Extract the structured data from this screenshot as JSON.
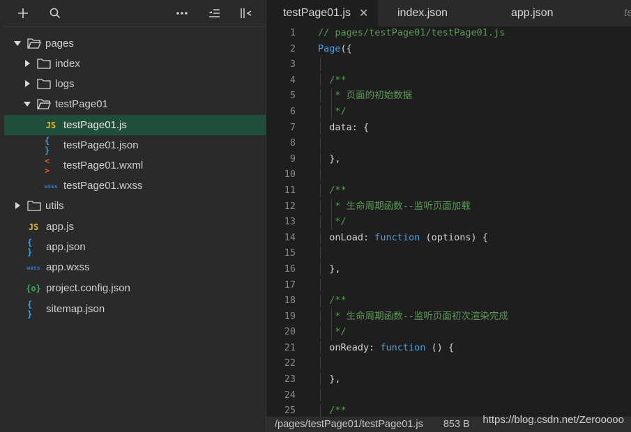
{
  "toolbar": {
    "add_icon": "plus-icon",
    "search_icon": "search-icon",
    "more_icon": "ellipsis-icon",
    "collapse_icon": "collapse-all-icon",
    "hide_panel_icon": "hide-sidebar-icon"
  },
  "tree": [
    {
      "label": "pages",
      "type": "folder",
      "expanded": true,
      "depth": 0
    },
    {
      "label": "index",
      "type": "folder",
      "expanded": false,
      "depth": 1
    },
    {
      "label": "logs",
      "type": "folder",
      "expanded": false,
      "depth": 1
    },
    {
      "label": "testPage01",
      "type": "folder",
      "expanded": true,
      "depth": 1
    },
    {
      "label": "testPage01.js",
      "type": "js",
      "badge": "JS",
      "depth": 2,
      "selected": true
    },
    {
      "label": "testPage01.json",
      "type": "json",
      "badge": "{ }",
      "depth": 2
    },
    {
      "label": "testPage01.wxml",
      "type": "wxml",
      "badge": "< >",
      "depth": 2
    },
    {
      "label": "testPage01.wxss",
      "type": "wxss",
      "badge": "wxss",
      "depth": 2
    },
    {
      "label": "utils",
      "type": "folder",
      "expanded": false,
      "depth": 0
    },
    {
      "label": "app.js",
      "type": "js",
      "badge": "JS",
      "depth": 1
    },
    {
      "label": "app.json",
      "type": "json",
      "badge": "{ }",
      "depth": 1
    },
    {
      "label": "app.wxss",
      "type": "wxss",
      "badge": "wxss",
      "depth": 1
    },
    {
      "label": "project.config.json",
      "type": "config",
      "badge": "{o}",
      "depth": 1
    },
    {
      "label": "sitemap.json",
      "type": "json",
      "badge": "{ }",
      "depth": 1
    }
  ],
  "tabs": [
    {
      "label": "testPage01.js",
      "active": true,
      "close": "✕"
    },
    {
      "label": "index.json",
      "active": false
    },
    {
      "label": "app.json",
      "active": false
    },
    {
      "label": "te",
      "active": false
    }
  ],
  "code": [
    {
      "n": "1",
      "tokens": [
        {
          "t": "// pages/testPage01/testPage01.js",
          "k": "comment"
        }
      ]
    },
    {
      "n": "2",
      "tokens": [
        {
          "t": "Page",
          "k": "func"
        },
        {
          "t": "({",
          "k": "punc"
        }
      ]
    },
    {
      "n": "3",
      "tokens": []
    },
    {
      "n": "4",
      "tokens": [
        {
          "t": "  /**",
          "k": "comment"
        }
      ]
    },
    {
      "n": "5",
      "tokens": [
        {
          "t": "   * 页面的初始数据",
          "k": "comment"
        }
      ]
    },
    {
      "n": "6",
      "tokens": [
        {
          "t": "   */",
          "k": "comment"
        }
      ]
    },
    {
      "n": "7",
      "tokens": [
        {
          "t": "  data: {",
          "k": "key"
        }
      ]
    },
    {
      "n": "8",
      "tokens": []
    },
    {
      "n": "9",
      "tokens": [
        {
          "t": "  },",
          "k": "punc"
        }
      ]
    },
    {
      "n": "10",
      "tokens": []
    },
    {
      "n": "11",
      "tokens": [
        {
          "t": "  /**",
          "k": "comment"
        }
      ]
    },
    {
      "n": "12",
      "tokens": [
        {
          "t": "   * 生命周期函数--监听页面加载",
          "k": "comment"
        }
      ]
    },
    {
      "n": "13",
      "tokens": [
        {
          "t": "   */",
          "k": "comment"
        }
      ]
    },
    {
      "n": "14",
      "tokens": [
        {
          "t": "  onLoad: ",
          "k": "key"
        },
        {
          "t": "function",
          "k": "func"
        },
        {
          "t": " (options) {",
          "k": "punc"
        }
      ]
    },
    {
      "n": "15",
      "tokens": []
    },
    {
      "n": "16",
      "tokens": [
        {
          "t": "  },",
          "k": "punc"
        }
      ]
    },
    {
      "n": "17",
      "tokens": []
    },
    {
      "n": "18",
      "tokens": [
        {
          "t": "  /**",
          "k": "comment"
        }
      ]
    },
    {
      "n": "19",
      "tokens": [
        {
          "t": "   * 生命周期函数--监听页面初次渲染完成",
          "k": "comment"
        }
      ]
    },
    {
      "n": "20",
      "tokens": [
        {
          "t": "   */",
          "k": "comment"
        }
      ]
    },
    {
      "n": "21",
      "tokens": [
        {
          "t": "  onReady: ",
          "k": "key"
        },
        {
          "t": "function",
          "k": "func"
        },
        {
          "t": " () {",
          "k": "punc"
        }
      ]
    },
    {
      "n": "22",
      "tokens": []
    },
    {
      "n": "23",
      "tokens": [
        {
          "t": "  },",
          "k": "punc"
        }
      ]
    },
    {
      "n": "24",
      "tokens": []
    },
    {
      "n": "25",
      "tokens": [
        {
          "t": "  /**",
          "k": "comment"
        }
      ]
    }
  ],
  "status": {
    "path": "/pages/testPage01/testPage01.js",
    "size": "853 B"
  },
  "watermark": "https://blog.csdn.net/Zerooooo",
  "colors": {
    "js": "#e8b730",
    "json": "#3aa0e0",
    "wxml": "#e0622e",
    "wxss": "#3a7cc8",
    "config": "#3aaa5a",
    "selected_row": "#1f4e3a"
  }
}
